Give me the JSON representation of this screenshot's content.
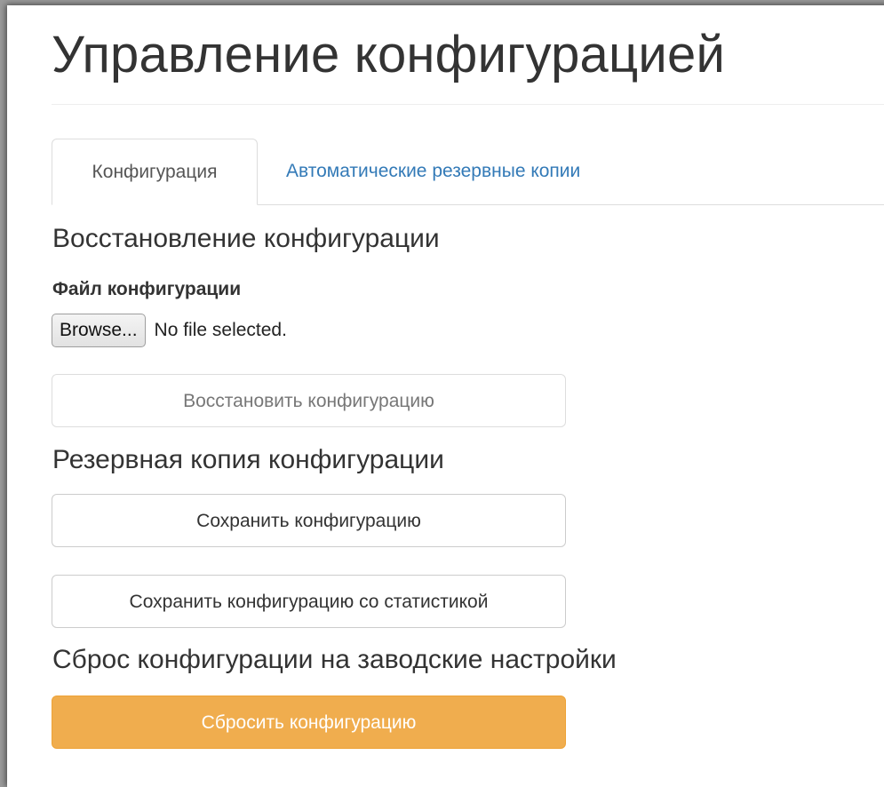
{
  "page": {
    "title": "Управление конфигурацией"
  },
  "tabs": [
    {
      "label": "Конфигурация",
      "active": true
    },
    {
      "label": "Автоматические резервные копии",
      "active": false
    }
  ],
  "restore": {
    "heading": "Восстановление конфигурации",
    "file_label": "Файл конфигурации",
    "browse_label": "Browse...",
    "file_status": "No file selected.",
    "button_label": "Восстановить конфигурацию",
    "button_disabled": true
  },
  "backup": {
    "heading": "Резервная копия конфигурации",
    "save_label": "Сохранить конфигурацию",
    "save_with_stats_label": "Сохранить конфигурацию со статистикой"
  },
  "reset": {
    "heading": "Сброс конфигурации на заводские настройки",
    "button_label": "Сбросить конфигурацию"
  },
  "colors": {
    "link": "#337ab7",
    "warning": "#f0ad4e",
    "text": "#333333",
    "border": "#dddddd"
  }
}
